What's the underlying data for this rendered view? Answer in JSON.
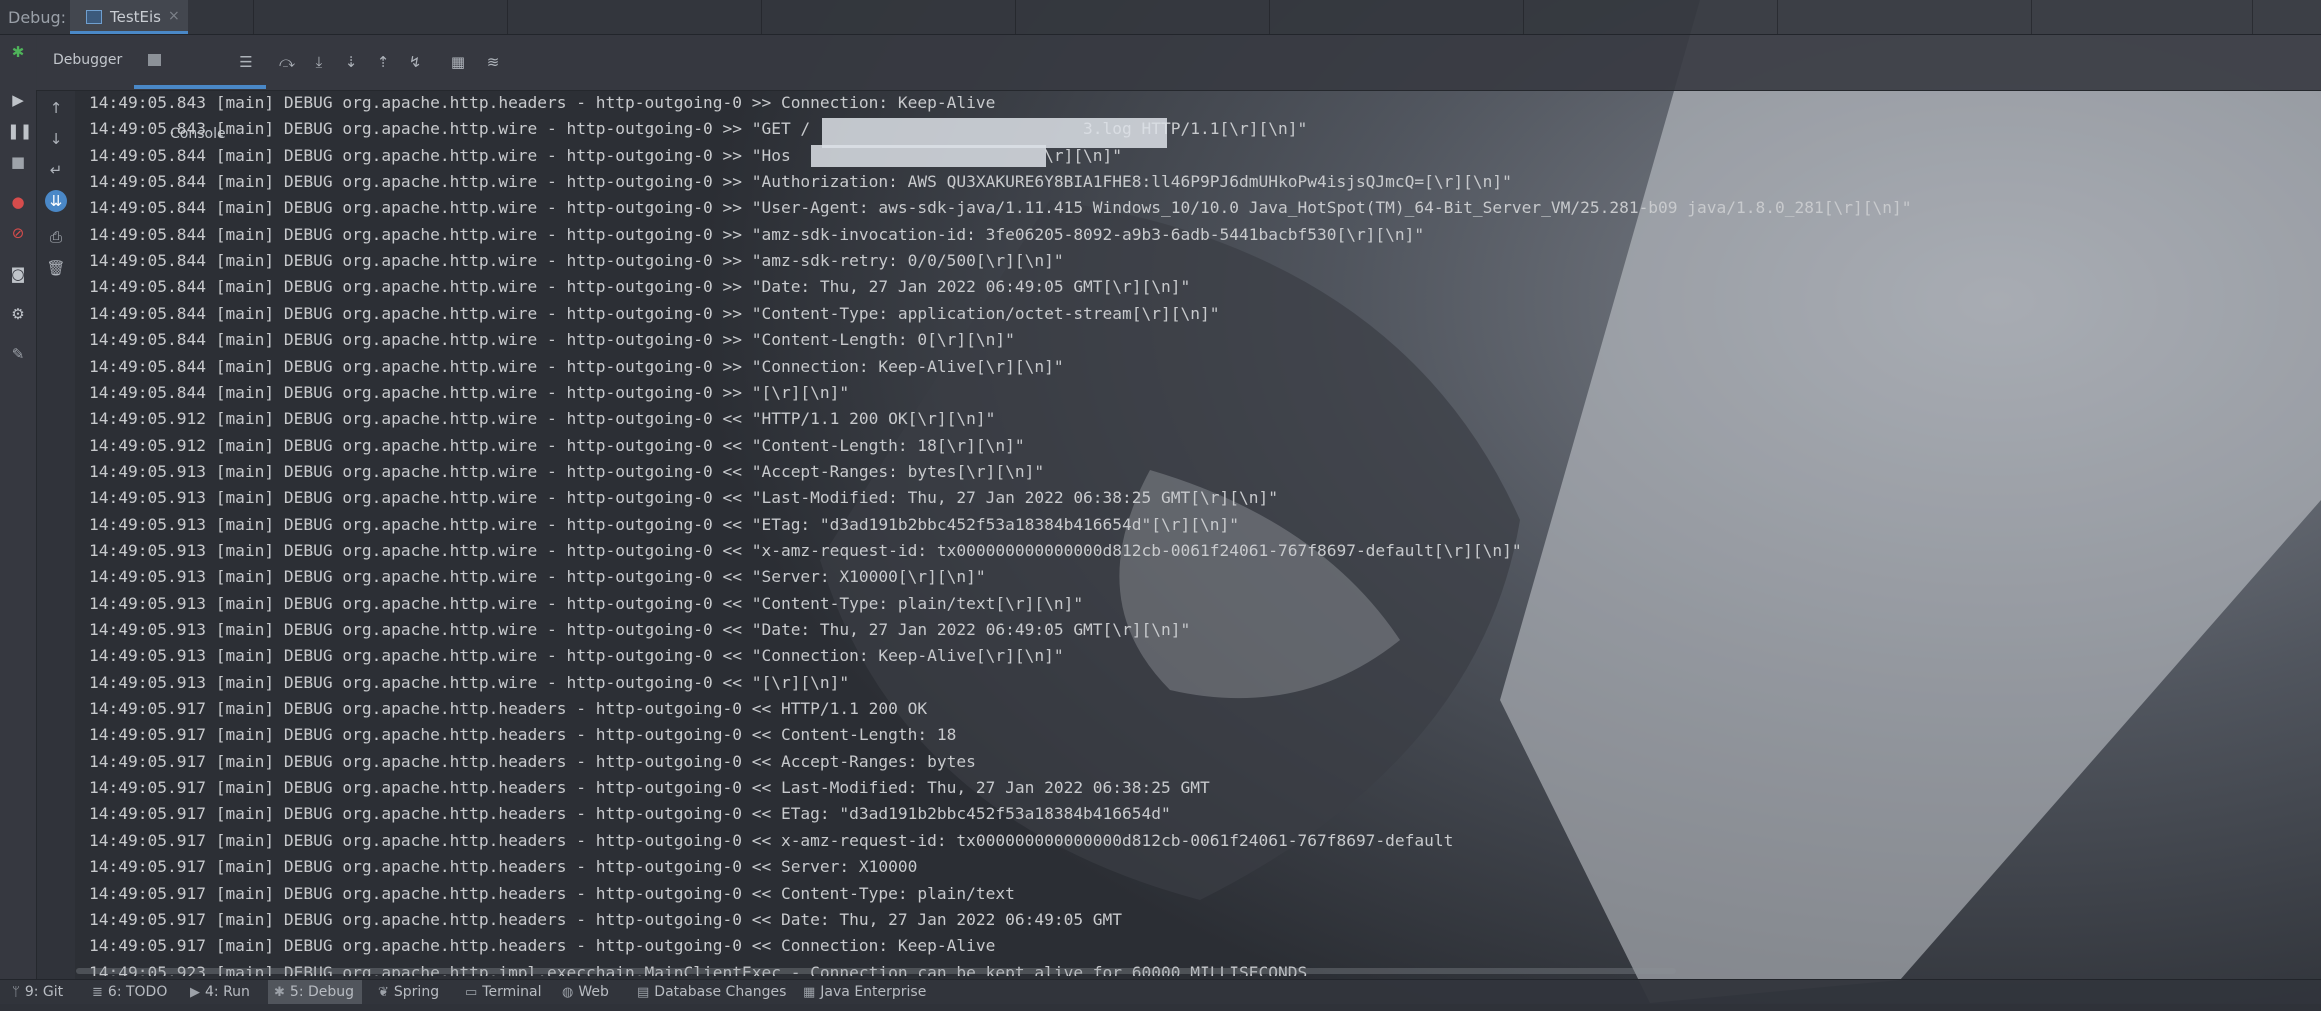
{
  "topbar": {
    "label": "Debug:",
    "tab_title": "TestEis",
    "tab_close": "×"
  },
  "toolbar": {
    "debugger_label": "Debugger",
    "console_label": "Console"
  },
  "console": {
    "lines": [
      "14:49:05.843 [main] DEBUG org.apache.http.headers - http-outgoing-0 >> Connection: Keep-Alive",
      "14:49:05.843 [main] DEBUG org.apache.http.wire - http-outgoing-0 >> \"GET /                            3.log HTTP/1.1[\\r][\\n]\"",
      "14:49:05.844 [main] DEBUG org.apache.http.wire - http-outgoing-0 >> \"Hos                          \\r][\\n]\"",
      "14:49:05.844 [main] DEBUG org.apache.http.wire - http-outgoing-0 >> \"Authorization: AWS QU3XAKURE6Y8BIA1FHE8:ll46P9PJ6dmUHkoPw4isjsQJmcQ=[\\r][\\n]\"",
      "14:49:05.844 [main] DEBUG org.apache.http.wire - http-outgoing-0 >> \"User-Agent: aws-sdk-java/1.11.415 Windows_10/10.0 Java_HotSpot(TM)_64-Bit_Server_VM/25.281-b09 java/1.8.0_281[\\r][\\n]\"",
      "14:49:05.844 [main] DEBUG org.apache.http.wire - http-outgoing-0 >> \"amz-sdk-invocation-id: 3fe06205-8092-a9b3-6adb-5441bacbf530[\\r][\\n]\"",
      "14:49:05.844 [main] DEBUG org.apache.http.wire - http-outgoing-0 >> \"amz-sdk-retry: 0/0/500[\\r][\\n]\"",
      "14:49:05.844 [main] DEBUG org.apache.http.wire - http-outgoing-0 >> \"Date: Thu, 27 Jan 2022 06:49:05 GMT[\\r][\\n]\"",
      "14:49:05.844 [main] DEBUG org.apache.http.wire - http-outgoing-0 >> \"Content-Type: application/octet-stream[\\r][\\n]\"",
      "14:49:05.844 [main] DEBUG org.apache.http.wire - http-outgoing-0 >> \"Content-Length: 0[\\r][\\n]\"",
      "14:49:05.844 [main] DEBUG org.apache.http.wire - http-outgoing-0 >> \"Connection: Keep-Alive[\\r][\\n]\"",
      "14:49:05.844 [main] DEBUG org.apache.http.wire - http-outgoing-0 >> \"[\\r][\\n]\"",
      "14:49:05.912 [main] DEBUG org.apache.http.wire - http-outgoing-0 << \"HTTP/1.1 200 OK[\\r][\\n]\"",
      "14:49:05.912 [main] DEBUG org.apache.http.wire - http-outgoing-0 << \"Content-Length: 18[\\r][\\n]\"",
      "14:49:05.913 [main] DEBUG org.apache.http.wire - http-outgoing-0 << \"Accept-Ranges: bytes[\\r][\\n]\"",
      "14:49:05.913 [main] DEBUG org.apache.http.wire - http-outgoing-0 << \"Last-Modified: Thu, 27 Jan 2022 06:38:25 GMT[\\r][\\n]\"",
      "14:49:05.913 [main] DEBUG org.apache.http.wire - http-outgoing-0 << \"ETag: \"d3ad191b2bbc452f53a18384b416654d\"[\\r][\\n]\"",
      "14:49:05.913 [main] DEBUG org.apache.http.wire - http-outgoing-0 << \"x-amz-request-id: tx000000000000000d812cb-0061f24061-767f8697-default[\\r][\\n]\"",
      "14:49:05.913 [main] DEBUG org.apache.http.wire - http-outgoing-0 << \"Server: X10000[\\r][\\n]\"",
      "14:49:05.913 [main] DEBUG org.apache.http.wire - http-outgoing-0 << \"Content-Type: plain/text[\\r][\\n]\"",
      "14:49:05.913 [main] DEBUG org.apache.http.wire - http-outgoing-0 << \"Date: Thu, 27 Jan 2022 06:49:05 GMT[\\r][\\n]\"",
      "14:49:05.913 [main] DEBUG org.apache.http.wire - http-outgoing-0 << \"Connection: Keep-Alive[\\r][\\n]\"",
      "14:49:05.913 [main] DEBUG org.apache.http.wire - http-outgoing-0 << \"[\\r][\\n]\"",
      "14:49:05.917 [main] DEBUG org.apache.http.headers - http-outgoing-0 << HTTP/1.1 200 OK",
      "14:49:05.917 [main] DEBUG org.apache.http.headers - http-outgoing-0 << Content-Length: 18",
      "14:49:05.917 [main] DEBUG org.apache.http.headers - http-outgoing-0 << Accept-Ranges: bytes",
      "14:49:05.917 [main] DEBUG org.apache.http.headers - http-outgoing-0 << Last-Modified: Thu, 27 Jan 2022 06:38:25 GMT",
      "14:49:05.917 [main] DEBUG org.apache.http.headers - http-outgoing-0 << ETag: \"d3ad191b2bbc452f53a18384b416654d\"",
      "14:49:05.917 [main] DEBUG org.apache.http.headers - http-outgoing-0 << x-amz-request-id: tx000000000000000d812cb-0061f24061-767f8697-default",
      "14:49:05.917 [main] DEBUG org.apache.http.headers - http-outgoing-0 << Server: X10000",
      "14:49:05.917 [main] DEBUG org.apache.http.headers - http-outgoing-0 << Content-Type: plain/text",
      "14:49:05.917 [main] DEBUG org.apache.http.headers - http-outgoing-0 << Date: Thu, 27 Jan 2022 06:49:05 GMT",
      "14:49:05.917 [main] DEBUG org.apache.http.headers - http-outgoing-0 << Connection: Keep-Alive",
      "14:49:05.923 [main] DEBUG org.apache.http.impl.execchain.MainClientExec - Connection can be kept alive for 60000 MILLISECONDS"
    ]
  },
  "statusbar": {
    "items": [
      {
        "number": "9",
        "label": "9: Git"
      },
      {
        "number": "6",
        "label": "6: TODO"
      },
      {
        "number": "4",
        "label": "4: Run"
      },
      {
        "number": "5",
        "label": "5: Debug"
      },
      {
        "number": "",
        "label": "Spring"
      },
      {
        "number": "",
        "label": "Terminal"
      },
      {
        "number": "",
        "label": "Web"
      },
      {
        "number": "",
        "label": "Database Changes"
      },
      {
        "number": "",
        "label": "Java Enterprise"
      }
    ]
  },
  "colors": {
    "accent": "#4a88c7",
    "console_text": "#c8cacd",
    "bug_icon": "#4fb35a",
    "stop_icon": "#d64c4c"
  }
}
